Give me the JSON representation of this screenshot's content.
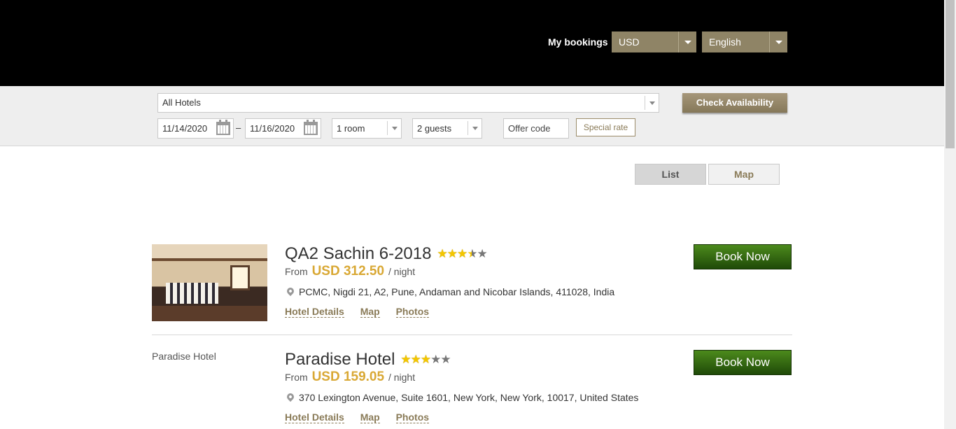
{
  "header": {
    "my_bookings": "My bookings",
    "currency": "USD",
    "language": "English"
  },
  "search": {
    "hotel": "All Hotels",
    "check_in": "11/14/2020",
    "dash": "–",
    "check_out": "11/16/2020",
    "rooms": "1 room",
    "guests": "2 guests",
    "offer_placeholder": "Offer code",
    "special_rate": "Special rate",
    "check_availability": "Check Availability"
  },
  "view": {
    "list": "List",
    "map": "Map"
  },
  "hotels": [
    {
      "name": "QA2 Sachin 6-2018",
      "rating": 3.5,
      "from": "From",
      "price": "USD 312.50",
      "per_night": "/ night",
      "address": "PCMC, Nigdi 21, A2, Pune, Andaman and Nicobar Islands, 411028, India",
      "links": [
        "Hotel Details",
        "Map",
        "Photos"
      ],
      "book": "Book Now"
    },
    {
      "name": "Paradise Hotel",
      "image_alt": "Paradise Hotel",
      "rating": 3,
      "from": "From",
      "price": "USD 159.05",
      "per_night": "/ night",
      "address": "370 Lexington Avenue, Suite 1601, New York, New York, 10017, United States",
      "links": [
        "Hotel Details",
        "Map",
        "Photos"
      ],
      "book": "Book Now"
    }
  ],
  "colors": {
    "accent": "#8f8466",
    "price": "#d9a834",
    "book_green": "#2f6a12"
  }
}
